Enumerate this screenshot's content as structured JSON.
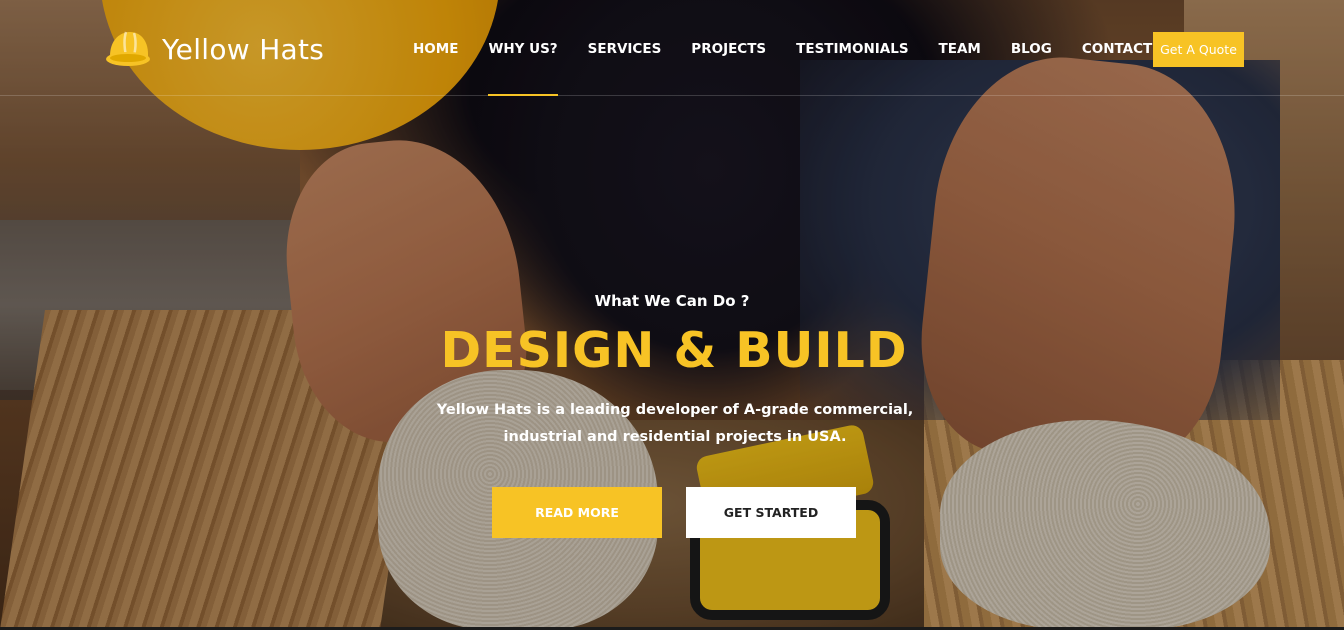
{
  "brand": {
    "name": "Yellow Hats",
    "icon": "hard-hat-icon",
    "accent": "#f7c325"
  },
  "nav": {
    "items": [
      {
        "label": "HOME",
        "active": false
      },
      {
        "label": "WHY US?",
        "active": true
      },
      {
        "label": "SERVICES",
        "active": false
      },
      {
        "label": "PROJECTS",
        "active": false
      },
      {
        "label": "TESTIMONIALS",
        "active": false
      },
      {
        "label": "TEAM",
        "active": false
      },
      {
        "label": "BLOG",
        "active": false
      },
      {
        "label": "CONTACT",
        "active": false
      }
    ],
    "quote_label": "Get A Quote"
  },
  "hero": {
    "subtitle": "What We Can Do ?",
    "title": "DESIGN & BUILD",
    "description": "Yellow Hats is a leading developer of A-grade commercial, industrial and residential projects in USA.",
    "read_more_label": "READ MORE",
    "get_started_label": "GET STARTED"
  }
}
